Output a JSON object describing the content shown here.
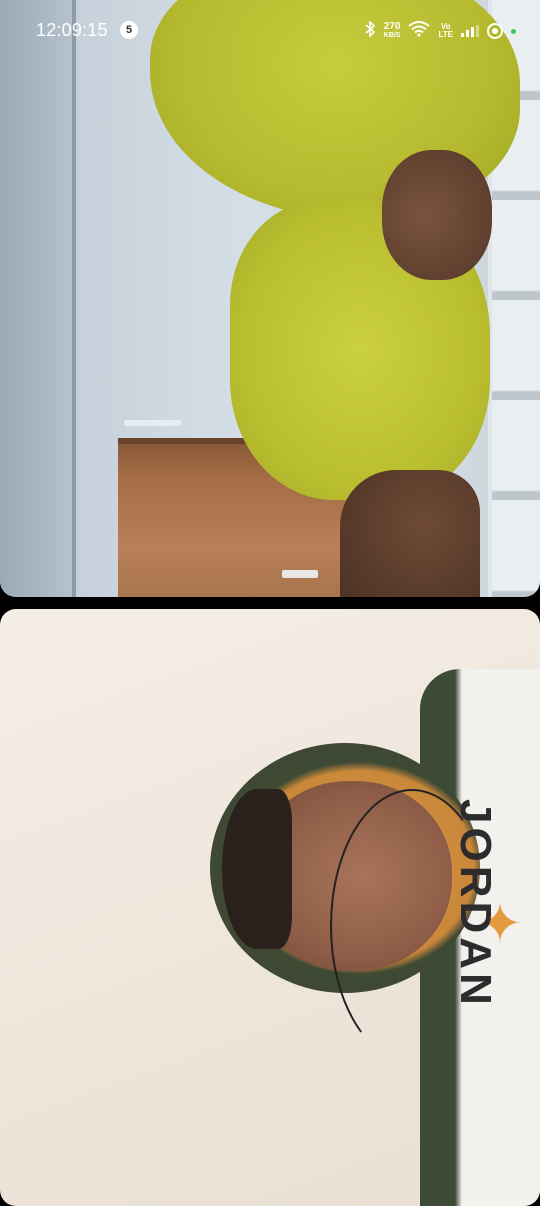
{
  "status_bar": {
    "time": "12:09:15",
    "notification_count": "5",
    "network_speed_value": "270",
    "network_speed_unit": "KB/S",
    "volte_top": "Vo",
    "volte_bottom": "LTE",
    "bluetooth_icon": "bluetooth-icon",
    "wifi_icon": "wifi-icon",
    "signal_icon": "cellular-signal-icon",
    "recording_icon": "screen-record-icon",
    "privacy_indicator_color": "#35c759"
  },
  "hoodie_print": "JORDAN",
  "colors": {
    "background": "#000000",
    "status_text": "#ffffff"
  }
}
